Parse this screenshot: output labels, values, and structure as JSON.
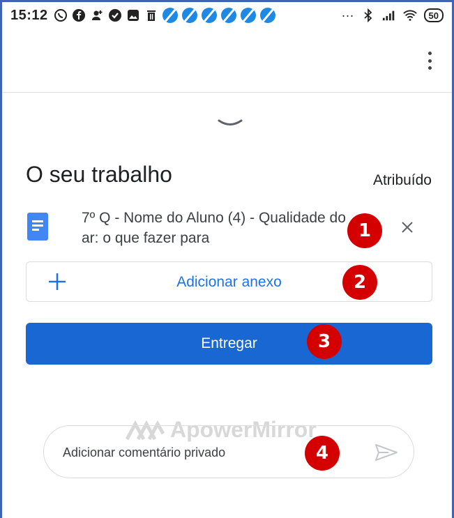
{
  "statusbar": {
    "time": "15:12",
    "notification_icons": [
      "whatsapp-icon",
      "facebook-icon",
      "add-person-icon",
      "check-circle-icon",
      "photo-icon",
      "trash-icon"
    ],
    "app_icons_count_label": "",
    "overflow_label": "···",
    "battery": "50"
  },
  "appbar": {
    "menu_icon": "more-vert-icon"
  },
  "work": {
    "title": "O seu trabalho",
    "status": "Atribuído",
    "attachment": {
      "name": "7º Q - Nome do Aluno (4) - Qualidade do ar: o que fazer para",
      "icon": "google-docs-icon"
    },
    "add_attachment_label": "Adicionar anexo",
    "submit_label": "Entregar"
  },
  "comment": {
    "placeholder": "Adicionar comentário privado",
    "send_icon": "send-icon"
  },
  "watermark": {
    "text": "ApowerMirror"
  },
  "annotations": [
    "1",
    "2",
    "3",
    "4"
  ],
  "colors": {
    "primary": "#1967d2",
    "link": "#1a73e8",
    "badge": "#d40000",
    "frame": "#3f64b4"
  }
}
